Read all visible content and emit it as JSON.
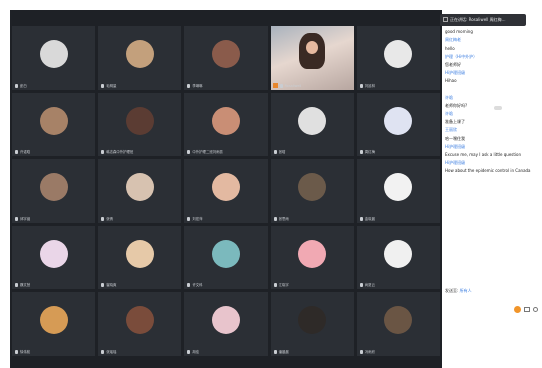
{
  "window_tooltip": "正在讲话: Rosaliwell 周红梅...",
  "participants": [
    {
      "label": "彭白",
      "avatar_color": "#d9d9d9"
    },
    {
      "label": "毛明量",
      "avatar_color": "#c3a07c"
    },
    {
      "label": "李琳琳",
      "avatar_color": "#8a5b4b"
    },
    {
      "label": "Rosaliwell",
      "avatar_color": "",
      "speaking": true
    },
    {
      "label": "刘延林",
      "avatar_color": "#e8e8e8"
    },
    {
      "label": "许诺晗",
      "avatar_color": "#a78267"
    },
    {
      "label": "韩志森中外护理班",
      "avatar_color": "#5b3c33"
    },
    {
      "label": "中外护理二班刘雨蕊",
      "avatar_color": "#c98e75"
    },
    {
      "label": "张晗",
      "avatar_color": "#e0e0e0"
    },
    {
      "label": "周红梅",
      "avatar_color": "#dfe3f2"
    },
    {
      "label": "邱宇涵",
      "avatar_color": "#9a7a66"
    },
    {
      "label": "张倩",
      "avatar_color": "#d7c2b0"
    },
    {
      "label": "刘宏萍",
      "avatar_color": "#e3b9a1"
    },
    {
      "label": "张思雨",
      "avatar_color": "#6b5a4a"
    },
    {
      "label": "金晓晨",
      "avatar_color": "#f2f2f2"
    },
    {
      "label": "魏文慧",
      "avatar_color": "#ead6e8"
    },
    {
      "label": "崔晓爽",
      "avatar_color": "#e6c9a8"
    },
    {
      "label": "许文科",
      "avatar_color": "#7bb9bd"
    },
    {
      "label": "江晓宇",
      "avatar_color": "#f1a9b3"
    },
    {
      "label": "尚夏云",
      "avatar_color": "#f0f0f0"
    },
    {
      "label": "徐伟航",
      "avatar_color": "#d69b55"
    },
    {
      "label": "张瑶瑶",
      "avatar_color": "#7a4c3b"
    },
    {
      "label": "胡佳",
      "avatar_color": "#e8c4cc"
    },
    {
      "label": "潘晨晨",
      "avatar_color": "#2e2a28"
    },
    {
      "label": "冯雨欣",
      "avatar_color": "#6a5544"
    }
  ],
  "chat": {
    "messages": [
      {
        "type": "name",
        "text": "Hi护理班级"
      },
      {
        "type": "text",
        "text": "good morning"
      },
      {
        "type": "name",
        "text": "周红梅老"
      },
      {
        "type": "text",
        "text": "hello"
      },
      {
        "type": "name",
        "text": "护理（Hi中外护）"
      },
      {
        "type": "text",
        "text": "您老师好"
      },
      {
        "type": "name",
        "text": "Hi护理班级"
      },
      {
        "type": "text",
        "text": "Hihao"
      },
      {
        "type": "gap",
        "text": ""
      },
      {
        "type": "name",
        "text": "许晗"
      },
      {
        "type": "text",
        "text": "老师你好吗?"
      },
      {
        "type": "name",
        "text": "许晗"
      },
      {
        "type": "text",
        "text": "准备上课了"
      },
      {
        "type": "name",
        "text": "王丽欣"
      },
      {
        "type": "text",
        "text": "哈—嘿住我"
      },
      {
        "type": "name",
        "text": "Hi护理班级"
      },
      {
        "type": "text",
        "text": "Excuse me, may I ask a little question"
      },
      {
        "type": "name",
        "text": "Hi护理班级"
      },
      {
        "type": "text",
        "text": "How about the epidemic control in Canada"
      }
    ],
    "footer_to_label": "发送至:",
    "footer_target": "所有人"
  }
}
